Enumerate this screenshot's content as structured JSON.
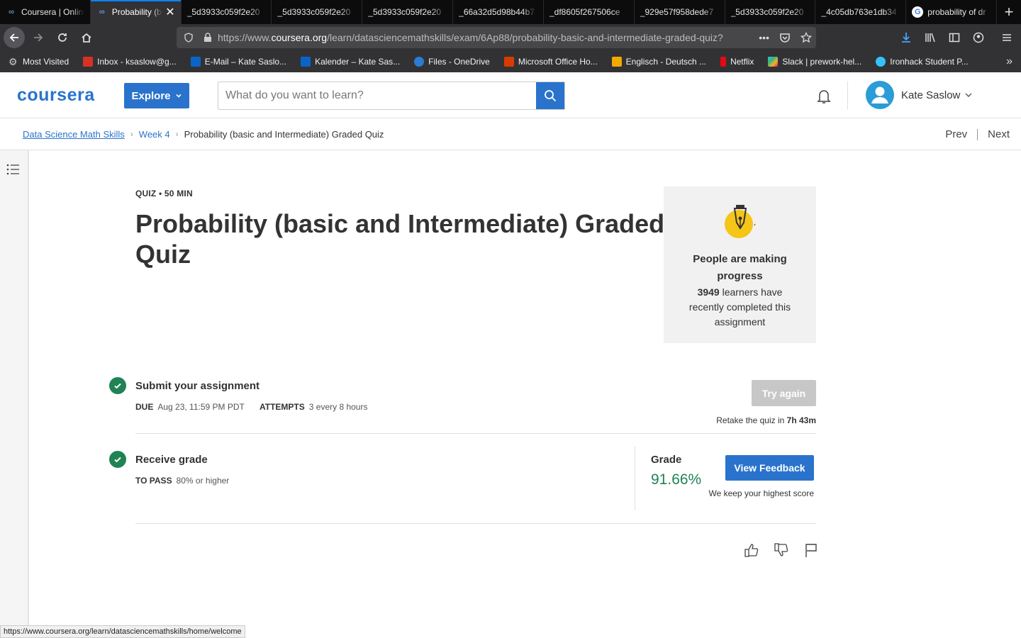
{
  "browser": {
    "tabs": [
      {
        "title": "Coursera | Online",
        "active": false
      },
      {
        "title": "Probability (basic",
        "active": true
      },
      {
        "title": "_5d3933c059f2e20",
        "active": false
      },
      {
        "title": "_5d3933c059f2e20",
        "active": false
      },
      {
        "title": "_5d3933c059f2e20",
        "active": false
      },
      {
        "title": "_66a32d5d98b44b7",
        "active": false
      },
      {
        "title": "_df8605f267506ce",
        "active": false
      },
      {
        "title": "_929e57f958dede7",
        "active": false
      },
      {
        "title": "_5d3933c059f2e20",
        "active": false
      },
      {
        "title": "_4c05db763e1db34",
        "active": false
      },
      {
        "title": "probability of dr",
        "active": false
      }
    ],
    "url_prefix": "https://www.",
    "url_host": "coursera.org",
    "url_path": "/learn/datasciencemathskills/exam/6Ap88/probability-basic-and-intermediate-graded-quiz?",
    "bookmarks": [
      {
        "label": "Most Visited",
        "color": "#9a9a9a"
      },
      {
        "label": "Inbox - ksaslow@g...",
        "color": "#d93025"
      },
      {
        "label": "E-Mail – Kate Saslo...",
        "color": "#0a64c8"
      },
      {
        "label": "Kalender – Kate Sas...",
        "color": "#0a64c8"
      },
      {
        "label": "Files - OneDrive",
        "color": "#2b7cd3"
      },
      {
        "label": "Microsoft Office Ho...",
        "color": "#d83b01"
      },
      {
        "label": "Englisch - Deutsch ...",
        "color": "#f2a900"
      },
      {
        "label": "Netflix",
        "color": "#e50914"
      },
      {
        "label": "Slack | prework-hel...",
        "color": "#4a154b"
      },
      {
        "label": "Ironhack Student P...",
        "color": "#32c3ff"
      }
    ]
  },
  "header": {
    "logo": "coursera",
    "explore_label": "Explore",
    "search_placeholder": "What do you want to learn?",
    "user_name": "Kate Saslow"
  },
  "breadcrumb": {
    "course": "Data Science Math Skills",
    "week": "Week 4",
    "current": "Probability (basic and Intermediate) Graded Quiz",
    "prev": "Prev",
    "next": "Next"
  },
  "quiz": {
    "meta": "QUIZ • 50 MIN",
    "title": "Probability (basic and Intermediate) Graded Quiz"
  },
  "progress_card": {
    "title": "People are making progress",
    "count": "3949",
    "body": "learners have recently completed this assignment"
  },
  "submit": {
    "title": "Submit your assignment",
    "due_label": "DUE",
    "due_value": "Aug 23, 11:59 PM PDT",
    "attempts_label": "ATTEMPTS",
    "attempts_value": "3 every 8 hours",
    "try_again": "Try again",
    "retake_prefix": "Retake the quiz in",
    "retake_time": "7h 43m"
  },
  "grade": {
    "title": "Receive grade",
    "pass_label": "TO PASS",
    "pass_value": "80% or higher",
    "label": "Grade",
    "value": "91.66%",
    "feedback_label": "View Feedback",
    "note": "We keep your highest score"
  },
  "status_url": "https://www.coursera.org/learn/datasciencemathskills/home/welcome",
  "colors": {
    "brand": "#2a73cc",
    "success": "#1f8354"
  }
}
